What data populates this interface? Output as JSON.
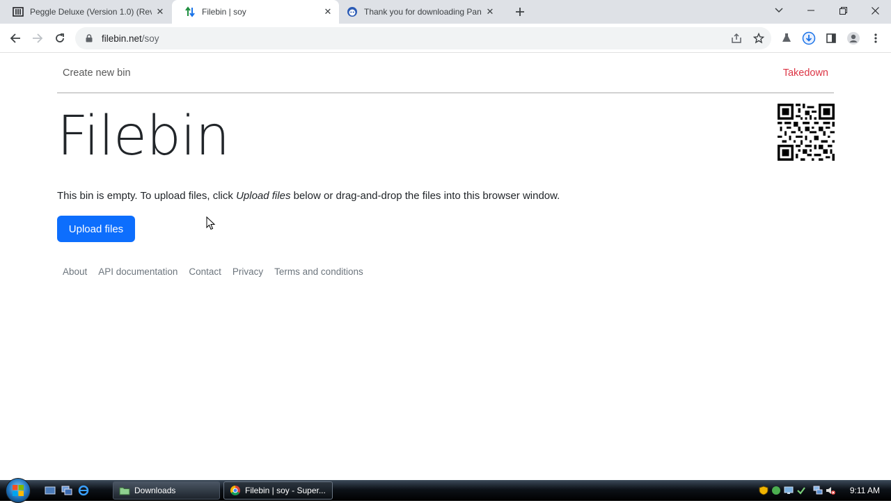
{
  "browser": {
    "tabs": [
      {
        "title": "Peggle Deluxe (Version 1.0) (Revi",
        "favicon": "library-icon",
        "active": false
      },
      {
        "title": "Filebin | soy",
        "favicon": "filebin-arrows-icon",
        "active": true
      },
      {
        "title": "Thank you for downloading Pan",
        "favicon": "panda-icon",
        "active": false
      }
    ],
    "url": {
      "host": "filebin.net",
      "path": "/soy"
    }
  },
  "page": {
    "nav": {
      "create_label": "Create new bin",
      "takedown_label": "Takedown"
    },
    "heading": "Filebin",
    "notice": {
      "before": "This bin is empty. To upload files, click ",
      "emphasis": "Upload files",
      "after": " below or drag-and-drop the files into this browser window."
    },
    "upload_label": "Upload files",
    "footer_links": [
      "About",
      "API documentation",
      "Contact",
      "Privacy",
      "Terms and conditions"
    ]
  },
  "taskbar": {
    "tasks": [
      {
        "label": "Downloads",
        "icon": "folder-icon",
        "active": false
      },
      {
        "label": "Filebin | soy - Super...",
        "icon": "chrome-icon",
        "active": true
      }
    ],
    "clock": "9:11 AM"
  },
  "colors": {
    "accent": "#0d6efd",
    "takedown": "#dc3545",
    "text": "#212529",
    "muted": "#6c757d"
  }
}
